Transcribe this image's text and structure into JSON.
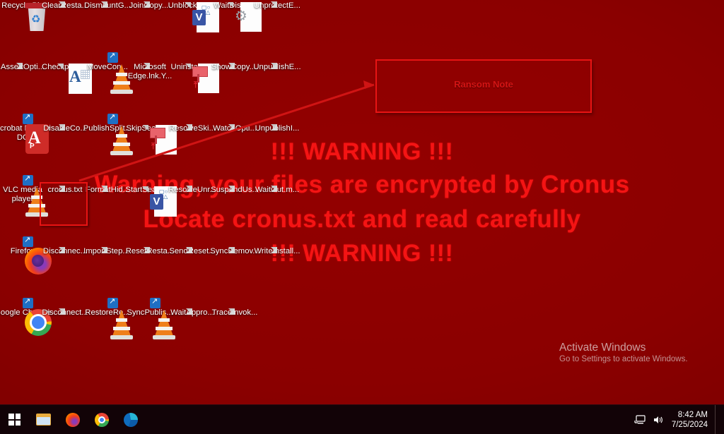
{
  "desktop": {
    "wallpaper_warning": {
      "line1": "!!! WARNING !!!",
      "line2": "Warning, your files are encrypted by Cronus",
      "line3": "Locate cronus.txt and read carefully",
      "line4": "!!! WARNING !!!",
      "text_color": "#f41414",
      "background_color": "#8b0000"
    },
    "annotations": {
      "ransom_note_label": "Ransom Note",
      "box_color": "#e81414",
      "highlighted_file": "cronus.txt"
    },
    "icons": [
      {
        "label": "Recycle Bin",
        "glyph": "recycle-bin-icon"
      },
      {
        "label": "ClearResta...",
        "glyph": "text-file-icon"
      },
      {
        "label": "DismountG...",
        "glyph": "text-file-icon"
      },
      {
        "label": "JoinCopy....",
        "glyph": "text-file-icon"
      },
      {
        "label": "UnblockSav...",
        "glyph": "visio-file-icon"
      },
      {
        "label": "WaitDisco...",
        "glyph": "gear-file-icon"
      },
      {
        "label": "UnprotectE...",
        "glyph": "text-file-icon"
      },
      {
        "label": "AssertOpti...",
        "glyph": "text-file-icon"
      },
      {
        "label": "Checkpoint...",
        "glyph": "font-file-icon"
      },
      {
        "label": "MoveCon...",
        "glyph": "vlc-cone-icon"
      },
      {
        "label": "Microsoft Edge.lnk.Y...",
        "glyph": "text-file-icon"
      },
      {
        "label": "UninstallR...",
        "glyph": "uninstall-file-icon"
      },
      {
        "label": "ShowCopy....",
        "glyph": "text-file-icon"
      },
      {
        "label": "UnpublishE...",
        "glyph": "text-file-icon"
      },
      {
        "label": "Acrobat Reader DC",
        "glyph": "acrobat-icon"
      },
      {
        "label": "DisableCo...",
        "glyph": "text-file-icon"
      },
      {
        "label": "PublishSplit...",
        "glyph": "vlc-cone-icon"
      },
      {
        "label": "SkipSearch...",
        "glyph": "uninstall-file-icon"
      },
      {
        "label": "ResolveSki...",
        "glyph": "text-file-icon"
      },
      {
        "label": "WatchOpti...",
        "glyph": "text-file-icon"
      },
      {
        "label": "UnpublishI...",
        "glyph": "text-file-icon"
      },
      {
        "label": "VLC media player",
        "glyph": "vlc-cone-icon"
      },
      {
        "label": "cronus.txt",
        "glyph": "text-file-icon"
      },
      {
        "label": "FormatHid...",
        "glyph": "text-file-icon"
      },
      {
        "label": "StartSearch...",
        "glyph": "visio-file-icon"
      },
      {
        "label": "ResolveUnr...",
        "glyph": "text-file-icon"
      },
      {
        "label": "SuspendUs...",
        "glyph": "text-file-icon"
      },
      {
        "label": "WaitOut.m...",
        "glyph": "text-file-icon"
      },
      {
        "label": "Firefox",
        "glyph": "firefox-icon"
      },
      {
        "label": "Disconnec...",
        "glyph": "text-file-icon"
      },
      {
        "label": "ImportStep....",
        "glyph": "text-file-icon"
      },
      {
        "label": "ResetResta...",
        "glyph": "text-file-icon"
      },
      {
        "label": "SendReset...",
        "glyph": "text-file-icon"
      },
      {
        "label": "SyncRemov...",
        "glyph": "text-file-icon"
      },
      {
        "label": "WriteInstall...",
        "glyph": "text-file-icon"
      },
      {
        "label": "Google Chrome",
        "glyph": "chrome-icon"
      },
      {
        "label": "Disconnect...",
        "glyph": "text-file-icon"
      },
      {
        "label": "RestoreRe...",
        "glyph": "vlc-cone-icon"
      },
      {
        "label": "SyncPublis...",
        "glyph": "vlc-cone-icon"
      },
      {
        "label": "WaitAppro...",
        "glyph": "text-file-icon"
      },
      {
        "label": "TraceInvok...",
        "glyph": "text-file-icon"
      }
    ]
  },
  "watermark": {
    "title": "Activate Windows",
    "subtitle": "Go to Settings to activate Windows."
  },
  "taskbar": {
    "buttons": [
      {
        "name": "start-button",
        "label": "Start"
      },
      {
        "name": "file-explorer-button",
        "label": "File Explorer"
      },
      {
        "name": "firefox-button",
        "label": "Firefox"
      },
      {
        "name": "chrome-button",
        "label": "Google Chrome"
      },
      {
        "name": "edge-button",
        "label": "Microsoft Edge"
      }
    ],
    "tray": {
      "network_icon": "network-icon",
      "volume_icon": "volume-icon",
      "time": "8:42 AM",
      "date": "7/25/2024"
    }
  }
}
